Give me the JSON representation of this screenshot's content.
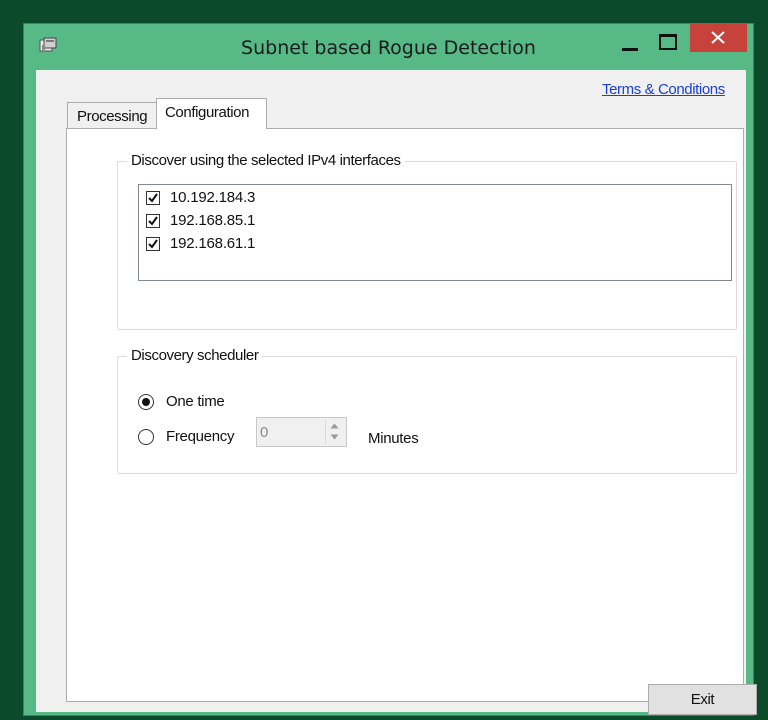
{
  "window": {
    "title": "Subnet based Rogue Detection"
  },
  "header": {
    "terms_link": "Terms & Conditions"
  },
  "tabs": [
    {
      "label": "Processing",
      "selected": false
    },
    {
      "label": "Configuration",
      "selected": true
    }
  ],
  "interfaces_group": {
    "legend": "Discover using the selected IPv4 interfaces",
    "items": [
      {
        "label": "10.192.184.3",
        "checked": true
      },
      {
        "label": "192.168.85.1",
        "checked": true
      },
      {
        "label": "192.168.61.1",
        "checked": true
      }
    ]
  },
  "scheduler_group": {
    "legend": "Discovery scheduler",
    "one_time_label": "One time",
    "one_time_selected": true,
    "frequency_label": "Frequency",
    "frequency_selected": false,
    "frequency_value": "0",
    "minutes_label": "Minutes"
  },
  "footer": {
    "exit_label": "Exit"
  },
  "colors": {
    "titlebar": "#57b986",
    "close_button": "#c7423a",
    "link": "#1a3fd3"
  },
  "icons": {
    "app": "app-icon",
    "minimize": "minimize-icon",
    "maximize": "maximize-icon",
    "close": "close-icon"
  }
}
